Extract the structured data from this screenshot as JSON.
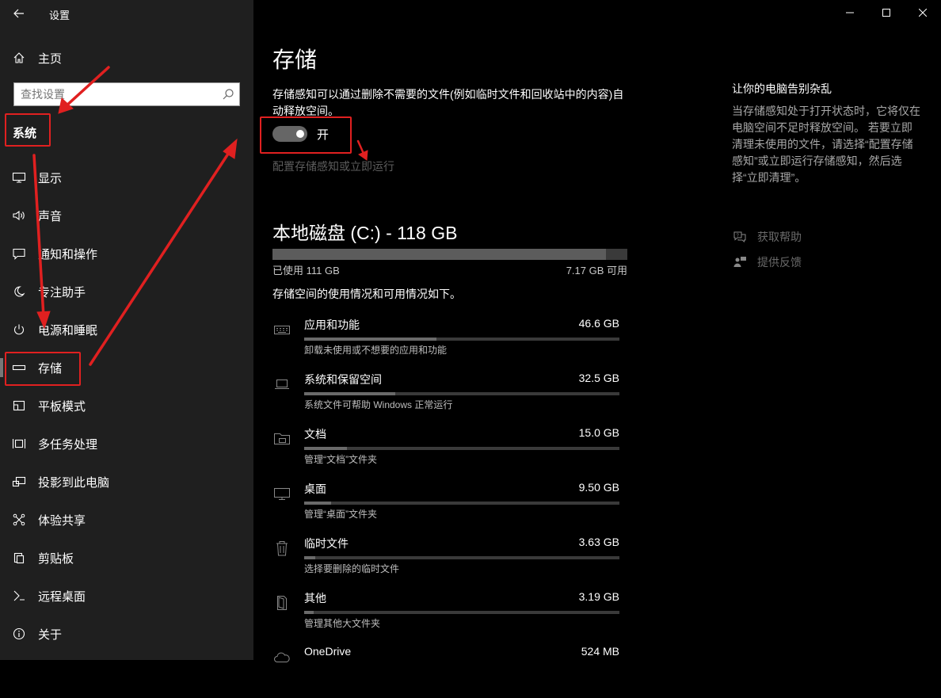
{
  "window": {
    "title": "设置",
    "controls": [
      "minimize-icon",
      "maximize-icon",
      "close-icon"
    ]
  },
  "sidebar": {
    "home_label": "主页",
    "search_placeholder": "查找设置",
    "section_title": "系统",
    "items": [
      {
        "label": "显示",
        "icon": "display-icon"
      },
      {
        "label": "声音",
        "icon": "speaker-icon"
      },
      {
        "label": "通知和操作",
        "icon": "notification-icon"
      },
      {
        "label": "专注助手",
        "icon": "moon-icon"
      },
      {
        "label": "电源和睡眠",
        "icon": "power-icon"
      },
      {
        "label": "存储",
        "icon": "storage-icon",
        "active": true
      },
      {
        "label": "平板模式",
        "icon": "tablet-icon"
      },
      {
        "label": "多任务处理",
        "icon": "multitask-icon"
      },
      {
        "label": "投影到此电脑",
        "icon": "project-icon"
      },
      {
        "label": "体验共享",
        "icon": "share-icon"
      },
      {
        "label": "剪贴板",
        "icon": "clipboard-icon"
      },
      {
        "label": "远程桌面",
        "icon": "remote-icon"
      },
      {
        "label": "关于",
        "icon": "info-icon"
      }
    ]
  },
  "main": {
    "title": "存储",
    "description": "存储感知可以通过删除不需要的文件(例如临时文件和回收站中的内容)自动释放空间。",
    "toggle": {
      "state": "on",
      "label": "开"
    },
    "config_link": "配置存储感知或立即运行",
    "disk": {
      "title": "本地磁盘 (C:) - 118 GB",
      "used_label": "已使用 111 GB",
      "free_label": "7.17 GB 可用",
      "used_fraction": 0.94
    },
    "usage_desc": "存储空间的使用情况和可用情况如下。",
    "categories": [
      {
        "name": "应用和功能",
        "size": "46.6 GB",
        "sub": "卸载未使用或不想要的应用和功能",
        "fraction": 0.42,
        "icon": "keyboard-icon"
      },
      {
        "name": "系统和保留空间",
        "size": "32.5 GB",
        "sub": "系统文件可帮助 Windows 正常运行",
        "fraction": 0.29,
        "icon": "laptop-icon"
      },
      {
        "name": "文档",
        "size": "15.0 GB",
        "sub": "管理“文档”文件夹",
        "fraction": 0.135,
        "icon": "folder-icon"
      },
      {
        "name": "桌面",
        "size": "9.50 GB",
        "sub": "管理“桌面”文件夹",
        "fraction": 0.085,
        "icon": "monitor-icon"
      },
      {
        "name": "临时文件",
        "size": "3.63 GB",
        "sub": "选择要删除的临时文件",
        "fraction": 0.035,
        "icon": "trash-icon"
      },
      {
        "name": "其他",
        "size": "3.19 GB",
        "sub": "管理其他大文件夹",
        "fraction": 0.03,
        "icon": "file-icon"
      },
      {
        "name": "OneDrive",
        "size": "524 MB",
        "sub": "",
        "fraction": 0.01,
        "icon": "cloud-icon"
      }
    ]
  },
  "side_panel": {
    "title": "让你的电脑告别杂乱",
    "description": "当存储感知处于打开状态时，它将仅在电脑空间不足时释放空间。 若要立即清理未使用的文件，请选择“配置存储感知”或立即运行存储感知，然后选择“立即清理”。",
    "help_label": "获取帮助",
    "feedback_label": "提供反馈"
  },
  "colors": {
    "annotation": "#e02020",
    "sidebar_bg": "#1f1f1f",
    "main_bg": "#000000"
  }
}
